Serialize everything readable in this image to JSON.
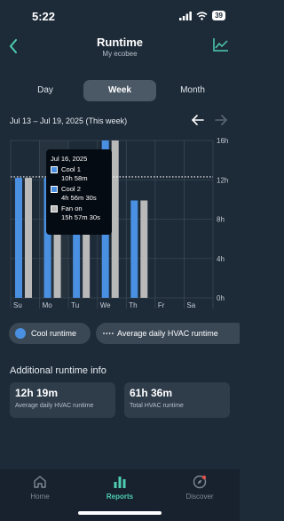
{
  "status_bar": {
    "time": "5:22",
    "battery": "39"
  },
  "header": {
    "title": "Runtime",
    "subtitle": "My ecobee"
  },
  "tabs": [
    {
      "label": "Day",
      "active": false
    },
    {
      "label": "Week",
      "active": true
    },
    {
      "label": "Month",
      "active": false
    }
  ],
  "range": {
    "label": "Jul 13 – Jul 19, 2025 (This week)"
  },
  "chart_data": {
    "type": "bar",
    "categories": [
      "Su",
      "Mo",
      "Tu",
      "We",
      "Th",
      "Fr",
      "Sa"
    ],
    "series": [
      {
        "name": "Cool runtime",
        "color": "#4a90e2",
        "values": [
          12.2,
          12.2,
          11.0,
          16.0,
          9.9,
          0,
          0
        ]
      },
      {
        "color": "#b9b9b9",
        "values": [
          12.2,
          12.2,
          11.0,
          16.0,
          9.9,
          0,
          0
        ]
      }
    ],
    "y_ticks": [
      "16h",
      "12h",
      "8h",
      "4h",
      "0h"
    ],
    "ylim": [
      0,
      16
    ],
    "average_line": 12.3,
    "highlighted_category": "Mo",
    "grid": true
  },
  "tooltip": {
    "date": "Jul 16, 2025",
    "rows": [
      {
        "label": "Cool 1",
        "value": "10h 58m",
        "color": "#4a90e2"
      },
      {
        "label": "Cool 2",
        "value": "4h 56m 30s",
        "color": "#4a90e2"
      },
      {
        "label": "Fan on",
        "value": "15h 57m 30s",
        "color": "#b9b9b9"
      }
    ]
  },
  "chips": {
    "cool_runtime": "Cool runtime",
    "average_hvac": "Average daily HVAC runtime"
  },
  "additional": {
    "title": "Additional runtime info",
    "cards": [
      {
        "value": "12h 19m",
        "label": "Average daily HVAC runtime"
      },
      {
        "value": "61h 36m",
        "label": "Total HVAC runtime"
      }
    ]
  },
  "bottom_nav": [
    {
      "label": "Home",
      "icon": "home-icon",
      "active": false
    },
    {
      "label": "Reports",
      "icon": "bar-chart-icon",
      "active": true
    },
    {
      "label": "Discover",
      "icon": "compass-icon",
      "active": false
    }
  ],
  "colors": {
    "background": "#1d2a38",
    "accent": "#4ecdb0",
    "cool": "#4a90e2",
    "fan": "#b9b9b9"
  }
}
